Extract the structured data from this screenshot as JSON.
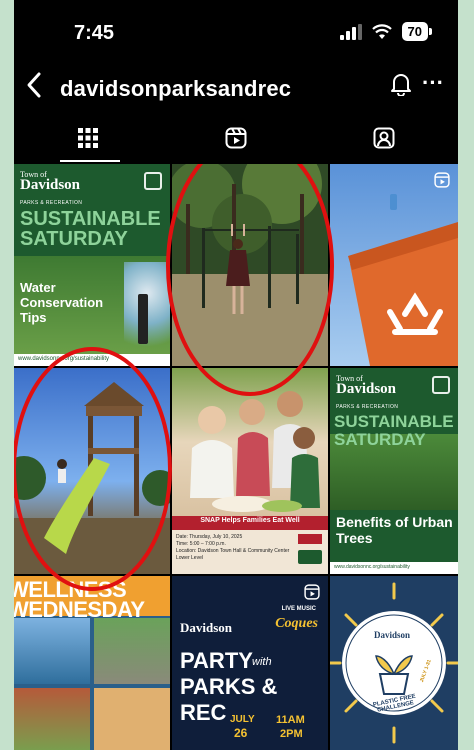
{
  "status_bar": {
    "time": "7:45",
    "battery": "70"
  },
  "header": {
    "username": "davidsonparksandrec",
    "back_icon": "chevron-left-icon",
    "bell_icon": "bell-icon",
    "more_label": "···"
  },
  "tabs": [
    {
      "name": "grid",
      "icon": "grid-icon",
      "selected": true
    },
    {
      "name": "reels",
      "icon": "reels-icon",
      "selected": false
    },
    {
      "name": "tagged",
      "icon": "tagged-icon",
      "selected": false
    }
  ],
  "posts": {
    "p1": {
      "logo_small": "Town of",
      "logo": "Davidson",
      "dept": "PARKS & RECREATION",
      "title_a": "SUSTAINABLE",
      "title_b": "SATURDAY",
      "sub": "Water Conservation Tips",
      "footer": "www.davidsonnc.org/sustainability"
    },
    "p3": {
      "graphic": "recycle-bin"
    },
    "p4": {
      "image": "playground-slide"
    },
    "p5": {
      "banner": "SNAP Helps Families Eat Well",
      "info_date": "Date: Thursday, July 10, 2025",
      "info_time": "Time: 5:00 – 7:00 p.m.",
      "info_loc": "Location: Davidson Town Hall & Community Center Lower Level"
    },
    "p6": {
      "logo_small": "Town of",
      "logo": "Davidson",
      "dept": "PARKS & RECREATION",
      "title_a": "SUSTAINABLE",
      "title_b": "SATURDAY",
      "sub": "Benefits of Urban Trees",
      "footer": "www.davidsonnc.org/sustainability"
    },
    "p7": {
      "title": "WELLNESS WEDNESDAY"
    },
    "p8": {
      "logo": "Davidson",
      "live": "LIVE MUSIC",
      "band": "Coques",
      "party": "PARTY",
      "with": "with",
      "parks": "PARKS & REC",
      "month": "JULY",
      "day": "26",
      "time_a": "11AM",
      "time_b": "2PM"
    },
    "p9": {
      "logo": "Davidson",
      "ring": "PLASTIC FREE CHALLENGE",
      "july": "JULY 1-31"
    }
  },
  "annotations": {
    "color": "#e01010"
  },
  "colors": {
    "accent_green": "#8ed39a",
    "dark_green": "#1d5a2e",
    "red": "#e01010"
  }
}
